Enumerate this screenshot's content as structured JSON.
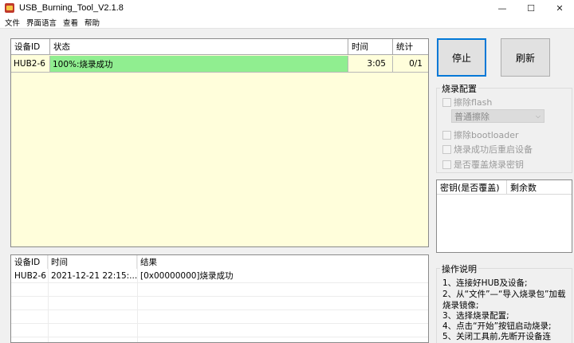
{
  "window": {
    "title": "USB_Burning_Tool_V2.1.8",
    "controls": {
      "minimize": "—",
      "maximize": "☐",
      "close": "✕"
    }
  },
  "menu": [
    "文件",
    "界面语言",
    "查看",
    "帮助"
  ],
  "device_table": {
    "headers": [
      "设备ID",
      "状态",
      "时间",
      "统计"
    ],
    "rows": [
      {
        "id": "HUB2-6",
        "status": "100%:烧录成功",
        "time": "3:05",
        "count": "0/1"
      }
    ]
  },
  "log_table": {
    "headers": [
      "设备ID",
      "时间",
      "结果"
    ],
    "rows": [
      {
        "id": "HUB2-6",
        "time": "2021-12-21 22:15:...",
        "result": "[0x00000000]烧录成功"
      }
    ]
  },
  "buttons": {
    "stop": "停止",
    "refresh": "刷新"
  },
  "burn_config": {
    "title": "烧录配置",
    "erase_flash": "擦除flash",
    "erase_mode": "普通擦除",
    "erase_bootloader": "擦除bootloader",
    "reboot_after": "烧录成功后重启设备",
    "overwrite_key": "是否覆盖烧录密钥"
  },
  "key_table": {
    "headers": [
      "密钥(是否覆盖)",
      "剩余数"
    ]
  },
  "instructions": {
    "title": "操作说明",
    "lines": [
      "1、连接好HUB及设备;",
      "2、从“文件”—“导入烧录包”加载",
      "烧录镜像;",
      "3、选择烧录配置;",
      "4、点击“开始”按钮启动烧录;",
      "5、关闭工具前,先断开设备连"
    ]
  },
  "colors": {
    "status_success": "#90ee90",
    "table_background": "#fffedb",
    "focus_border": "#0078d7"
  }
}
